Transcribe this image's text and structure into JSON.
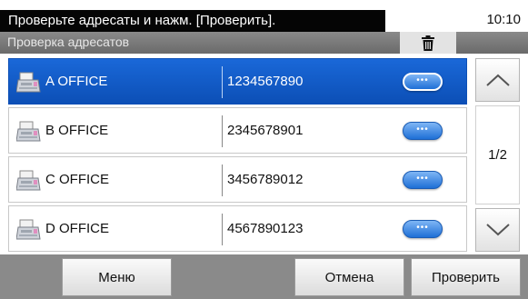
{
  "status_bar": {
    "message": "Проверьте адресаты и нажм. [Проверить].",
    "time": "10:10"
  },
  "header": {
    "title": "Проверка адресатов",
    "delete_icon": "trash-icon"
  },
  "destinations": [
    {
      "name": "A OFFICE",
      "number": "1234567890",
      "icon": "fax-icon",
      "selected": true
    },
    {
      "name": "B OFFICE",
      "number": "2345678901",
      "icon": "fax-icon",
      "selected": false
    },
    {
      "name": "C OFFICE",
      "number": "3456789012",
      "icon": "fax-icon",
      "selected": false
    },
    {
      "name": "D OFFICE",
      "number": "4567890123",
      "icon": "fax-icon",
      "selected": false
    }
  ],
  "detail_button_glyph": "•••",
  "pager": {
    "text": "1/2",
    "up_icon": "chevron-up-icon",
    "down_icon": "chevron-down-icon"
  },
  "footer": {
    "menu_label": "Меню",
    "cancel_label": "Отмена",
    "confirm_label": "Проверить"
  },
  "colors": {
    "selected_row": "#1560d0",
    "detail_button": "#2a7be0",
    "footer_bg": "#8a8a8a"
  }
}
